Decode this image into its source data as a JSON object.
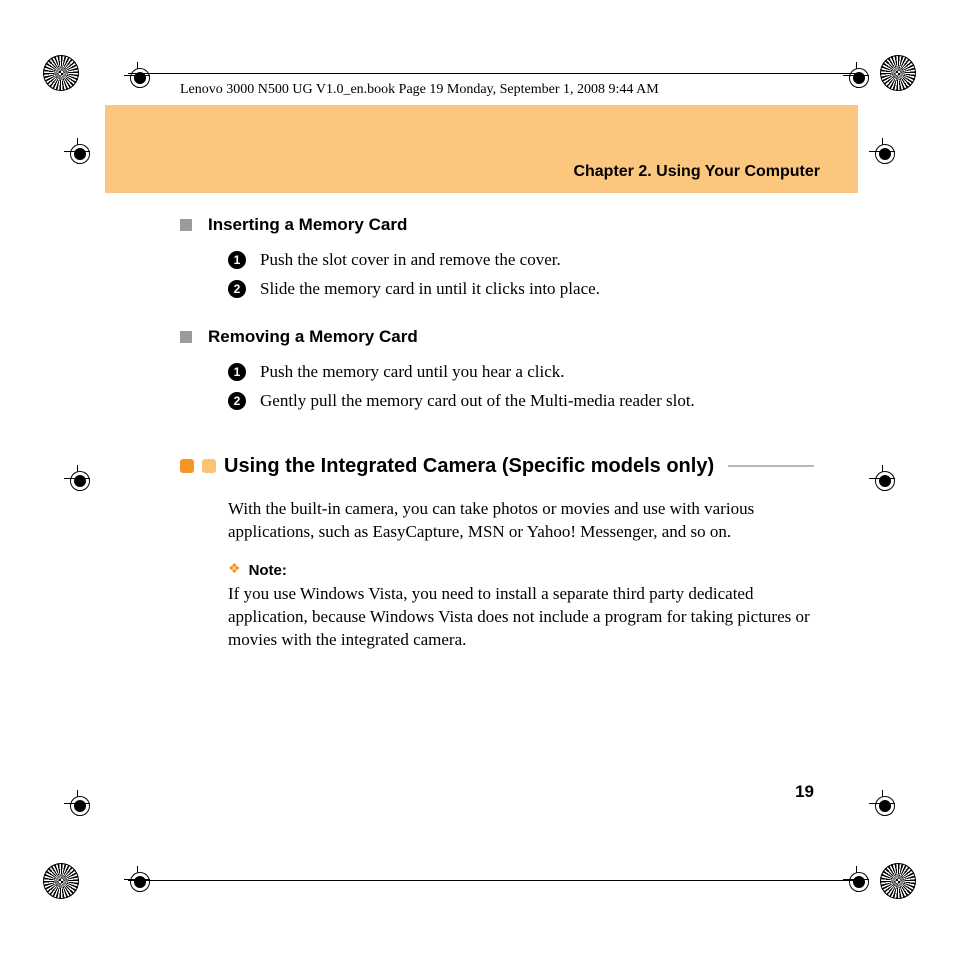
{
  "docHeader": "Lenovo 3000 N500 UG V1.0_en.book  Page 19  Monday, September 1, 2008  9:44 AM",
  "chapterTitle": "Chapter 2. Using Your Computer",
  "sections": {
    "insert": {
      "heading": "Inserting a Memory Card",
      "steps": [
        "Push the slot cover in and remove the cover.",
        "Slide the memory card in until it clicks into place."
      ]
    },
    "remove": {
      "heading": "Removing a Memory Card",
      "steps": [
        "Push the memory card until you hear a click.",
        "Gently pull the memory card out of the Multi-media reader slot."
      ]
    }
  },
  "majorHeading": "Using the Integrated Camera (Specific models only)",
  "cameraIntro": "With the built-in camera, you can take photos or movies and use with various applications, such as EasyCapture, MSN or Yahoo! Messenger, and so on.",
  "note": {
    "label": "Note:",
    "text": "If you use Windows Vista, you need to install a separate third party dedicated application, because Windows Vista does not include a program for taking pictures or movies with the integrated camera."
  },
  "pageNumber": "19"
}
